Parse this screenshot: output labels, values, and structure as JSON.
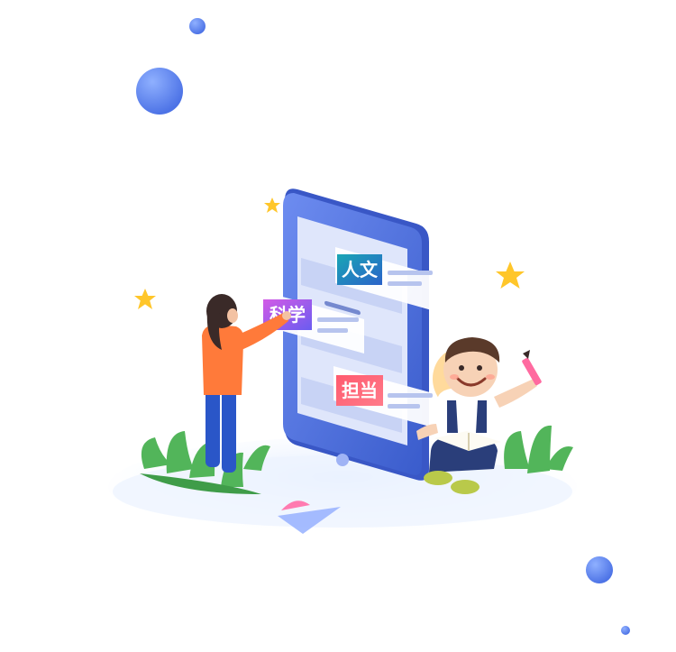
{
  "illustration": {
    "cards": [
      {
        "label": "人文",
        "color_from": "#1aa6b5",
        "color_to": "#2a62c9"
      },
      {
        "label": "科学",
        "color_from": "#d35be6",
        "color_to": "#6a5cf0"
      },
      {
        "label": "担当",
        "color_from": "#ff5a6e",
        "color_to": "#ff7b8a"
      }
    ],
    "colors": {
      "phone_body": "#4a6bd8",
      "phone_screen": "#dfe6fb",
      "bubble": "#5b84ee",
      "star": "#ffc62a",
      "plant": "#52b55a",
      "ground": "#eaf2ff"
    }
  }
}
